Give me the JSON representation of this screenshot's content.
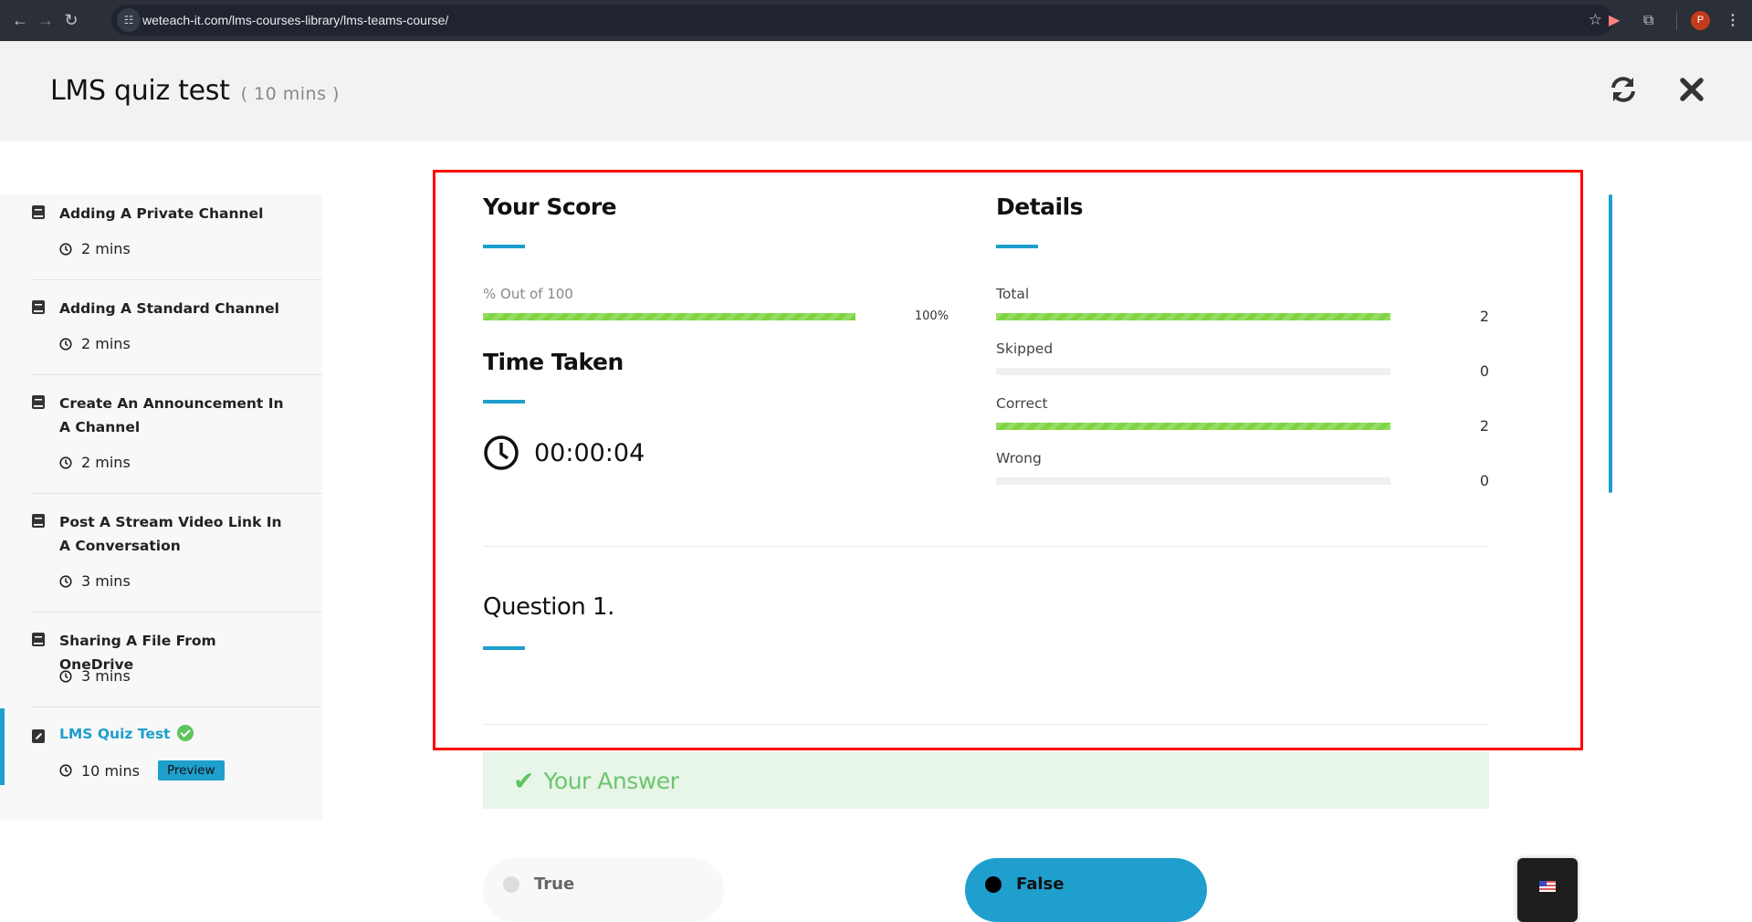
{
  "browser": {
    "url": "weteach-it.com/lms-courses-library/lms-teams-course/",
    "profile_initial": "P"
  },
  "header": {
    "title": "LMS quiz test",
    "duration": "( 10 mins )",
    "refresh_label": "Restart quiz",
    "close_label": "Close"
  },
  "sidebar": {
    "lessons": [
      {
        "title": "Adding A Private Channel",
        "duration": "2 mins",
        "icon": "book-icon"
      },
      {
        "title": "Adding A Standard Channel",
        "duration": "2 mins",
        "icon": "book-icon"
      },
      {
        "title": "Create An Announcement In A Channel",
        "duration": "2 mins",
        "icon": "book-icon"
      },
      {
        "title": "Post A Stream Video Link In A Conversation",
        "duration": "3 mins",
        "icon": "book-icon"
      },
      {
        "title": "Sharing A File From OneDrive",
        "duration": "3 mins",
        "icon": "book-icon"
      },
      {
        "title": "LMS Quiz Test",
        "duration": "10 mins",
        "icon": "edit-icon",
        "active": true,
        "completed": true,
        "badge": "Preview"
      }
    ]
  },
  "score": {
    "title": "Your Score",
    "label": "% Out of 100",
    "percent": 100,
    "percent_text": "100%"
  },
  "time": {
    "title": "Time Taken",
    "value": "00:00:04"
  },
  "details": {
    "title": "Details",
    "total_questions": 2,
    "rows": [
      {
        "label": "Total",
        "value": 2,
        "value_text": "2"
      },
      {
        "label": "Skipped",
        "value": 0,
        "value_text": "0"
      },
      {
        "label": "Correct",
        "value": 2,
        "value_text": "2"
      },
      {
        "label": "Wrong",
        "value": 0,
        "value_text": "0"
      }
    ]
  },
  "question": {
    "title": "Question 1.",
    "answer_banner": "Your Answer",
    "options": [
      {
        "label": "True",
        "selected": false
      },
      {
        "label": "False",
        "selected": true
      }
    ]
  },
  "colors": {
    "accent": "#1e9fcd",
    "success": "#7ed442",
    "highlight_border": "#ff0000"
  },
  "language": {
    "current": "en-US"
  }
}
